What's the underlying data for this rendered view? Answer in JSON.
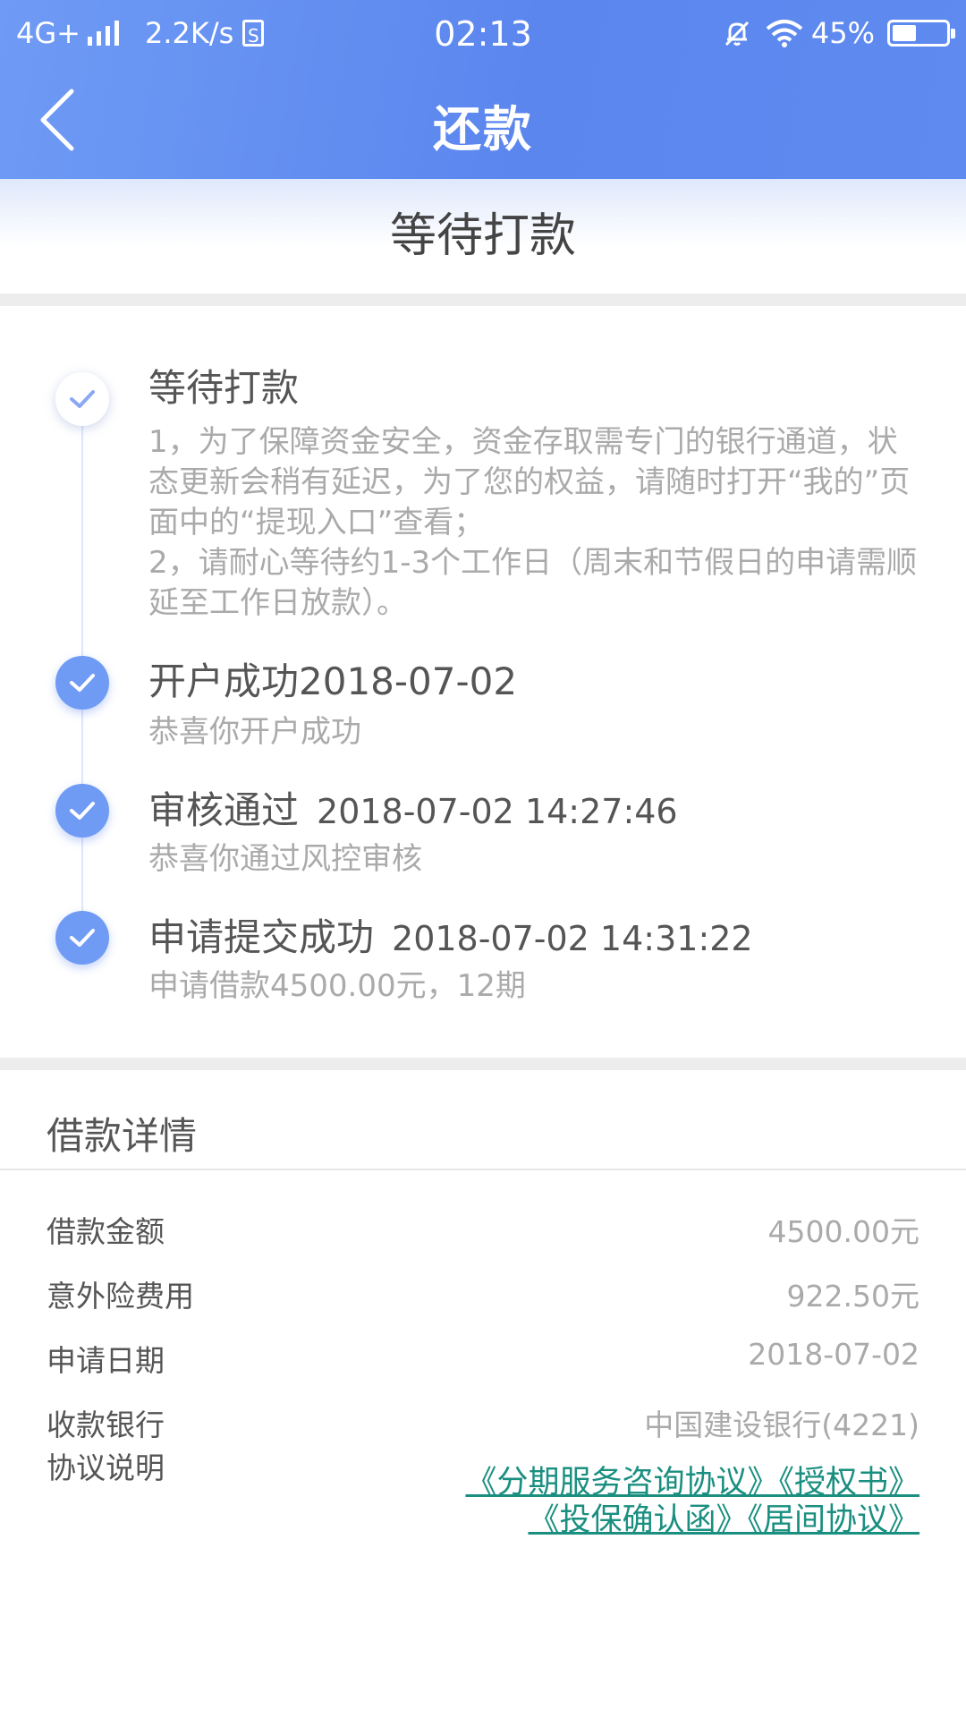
{
  "status_bar": {
    "network": "4G+",
    "speed": "2.2K/s",
    "sim_glyph": "S",
    "time": "02:13",
    "battery": "45%",
    "battery_level": 0.45,
    "icons": [
      "signal-icon",
      "sim-icon",
      "mute-bell-icon",
      "wifi-icon",
      "battery-icon"
    ]
  },
  "nav": {
    "title": "还款",
    "back_icon": "chevron-left-icon"
  },
  "banner": {
    "text": "等待打款"
  },
  "timeline": [
    {
      "title": "等待打款",
      "time": "",
      "state": "pending",
      "desc": [
        "1，为了保障资金安全，资金存取需专门的银行通道，状态更新会稍有延迟，为了您的权益，请随时打开“我的”页面中的“提现入口”查看；",
        "2，请耐心等待约1-3个工作日（周末和节假日的申请需顺延至工作日放款）。"
      ]
    },
    {
      "title": "开户成功2018-07-02",
      "time": "",
      "state": "done",
      "desc": [
        "恭喜你开户成功"
      ]
    },
    {
      "title": "审核通过",
      "time": "2018-07-02 14:27:46",
      "state": "done",
      "desc": [
        "恭喜你通过风控审核"
      ]
    },
    {
      "title": "申请提交成功",
      "time": "2018-07-02 14:31:22",
      "state": "done",
      "desc": [
        "申请借款4500.00元，12期"
      ]
    }
  ],
  "details": {
    "title": "借款详情",
    "rows": [
      {
        "label": "借款金额",
        "value": "4500.00元"
      },
      {
        "label": "意外险费用",
        "value": "922.50元"
      },
      {
        "label": "申请日期",
        "value": "2018-07-02"
      },
      {
        "label": "收款银行",
        "value": "中国建设银行(4221)"
      }
    ],
    "agreement_label": "协议说明",
    "agreements": [
      "《分期服务咨询协议》",
      "《授权书》",
      "《投保确认函》",
      "《居间协议》"
    ]
  },
  "colors": {
    "header_start": "#6f9bf5",
    "header_end": "#5b86ee",
    "check_dot": "#6f9bf5",
    "link": "#1a8f80",
    "muted_text": "#aaaaaa"
  }
}
